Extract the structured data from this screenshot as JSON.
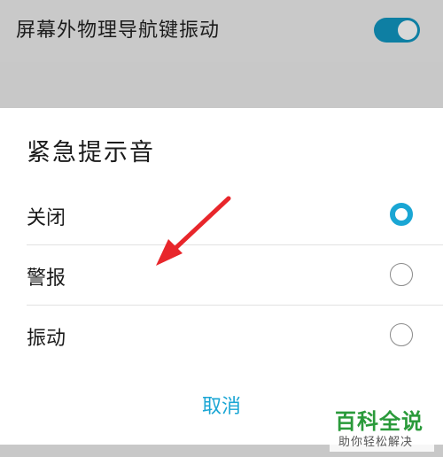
{
  "background_setting": {
    "label": "屏幕外物理导航键振动",
    "toggle_on": true
  },
  "dialog": {
    "title": "紧急提示音",
    "options": [
      {
        "label": "关闭",
        "selected": true
      },
      {
        "label": "警报",
        "selected": false
      },
      {
        "label": "振动",
        "selected": false
      }
    ],
    "cancel_label": "取消"
  },
  "watermark": {
    "title": "百科全说",
    "subtitle": "助你轻松解决"
  },
  "colors": {
    "accent": "#1aa6d4",
    "toggle": "#0e7fa3",
    "arrow": "#e8262b",
    "watermark_green": "#2a9a3a"
  }
}
